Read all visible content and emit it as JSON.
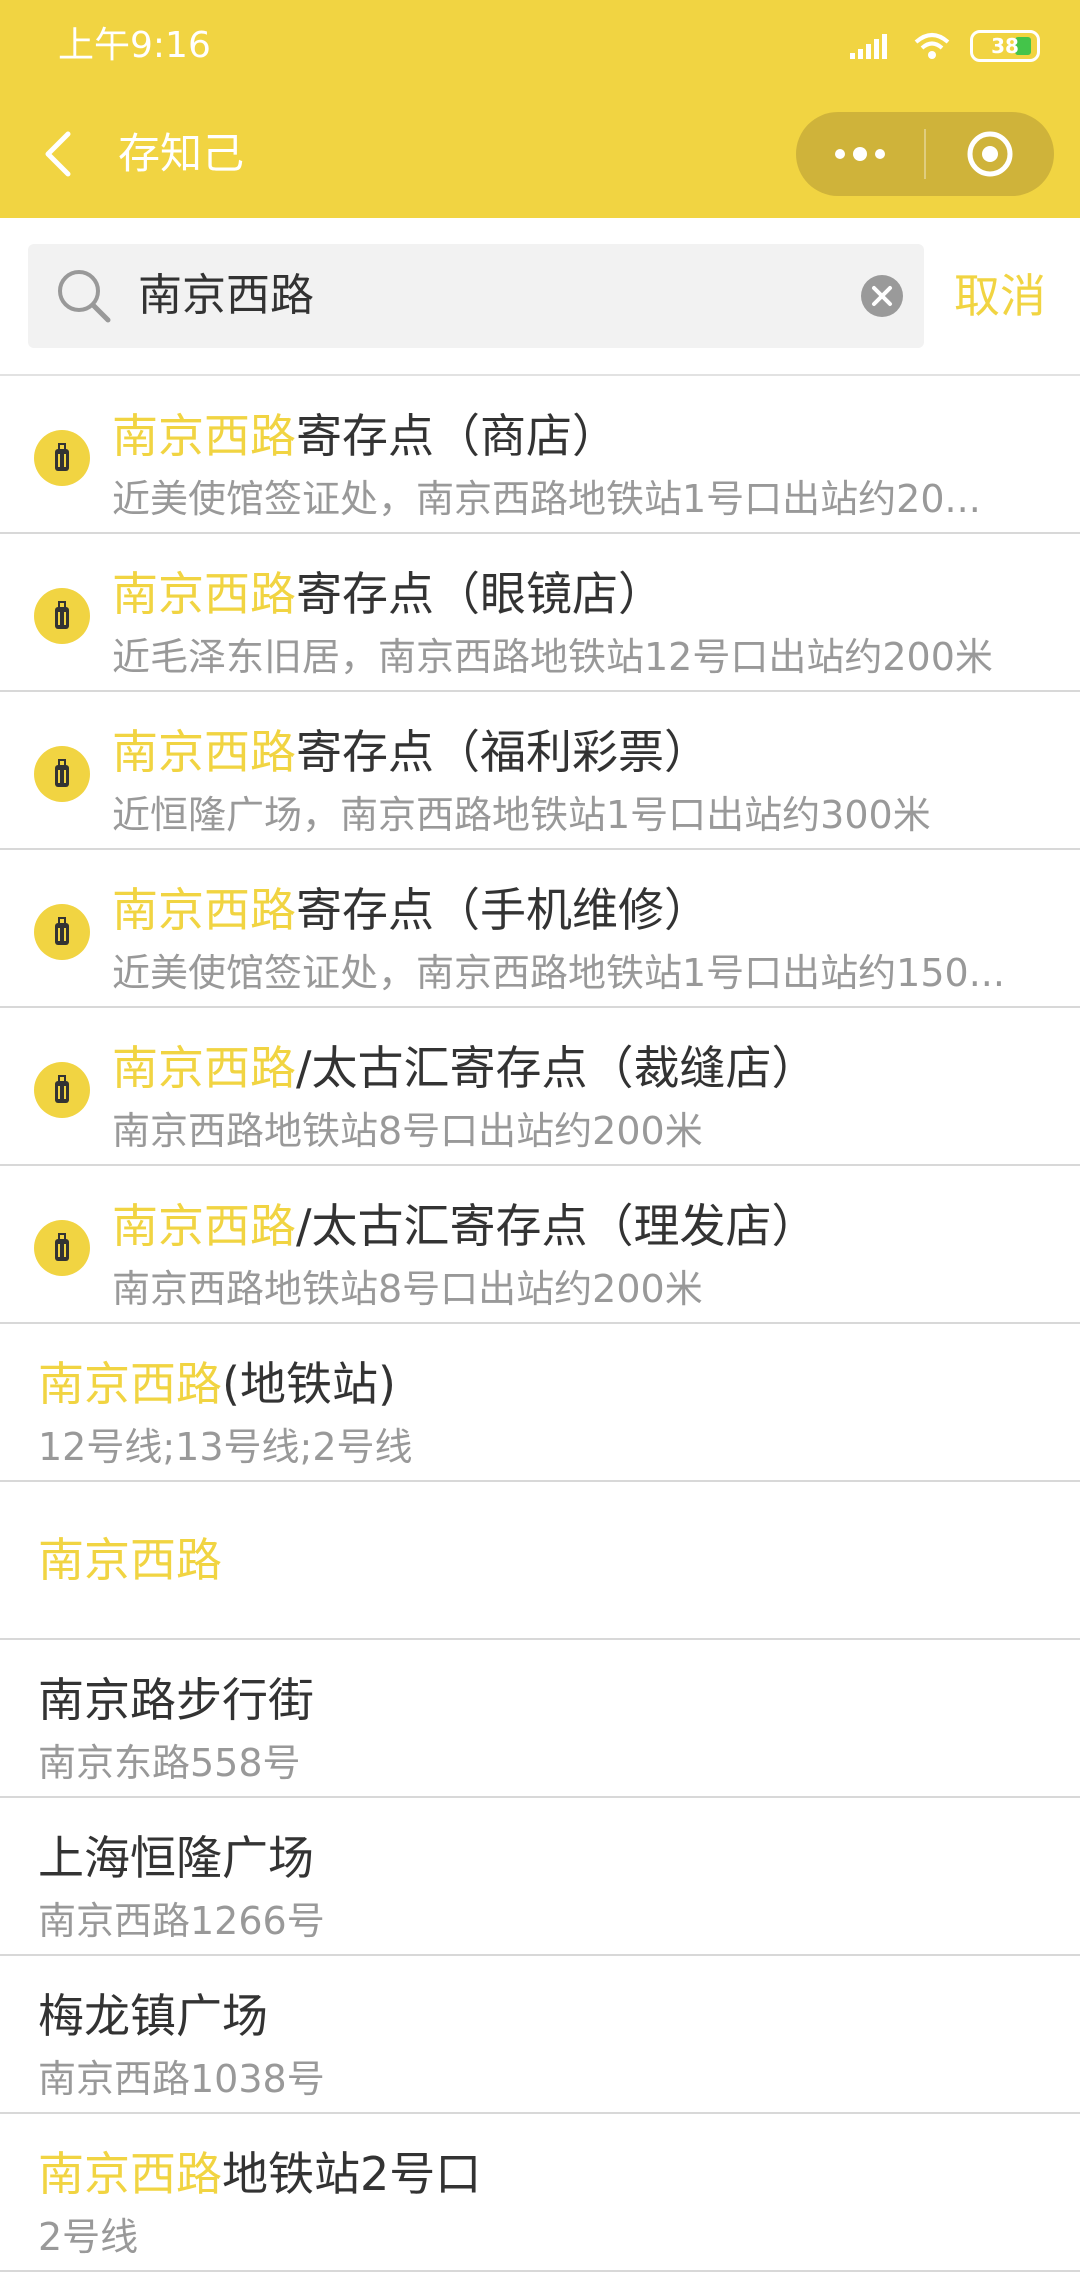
{
  "status_bar": {
    "time": "上午9:16",
    "battery": "38"
  },
  "nav": {
    "title": "存知己"
  },
  "search": {
    "query": "南京西路",
    "cancel_label": "取消"
  },
  "results": [
    {
      "highlight": "南京西路",
      "rest": "寄存点（商店）",
      "subtitle": "近美使馆签证处，南京西路地铁站1号口出站约20...",
      "icon": "storage-pin-icon"
    },
    {
      "highlight": "南京西路",
      "rest": "寄存点（眼镜店）",
      "subtitle": "近毛泽东旧居，南京西路地铁站12号口出站约200米",
      "icon": "storage-pin-icon"
    },
    {
      "highlight": "南京西路",
      "rest": "寄存点（福利彩票）",
      "subtitle": "近恒隆广场，南京西路地铁站1号口出站约300米",
      "icon": "storage-pin-icon"
    },
    {
      "highlight": "南京西路",
      "rest": "寄存点（手机维修）",
      "subtitle": "近美使馆签证处，南京西路地铁站1号口出站约150...",
      "icon": "storage-pin-icon"
    },
    {
      "highlight": "南京西路",
      "rest": "/太古汇寄存点（裁缝店）",
      "subtitle": "南京西路地铁站8号口出站约200米",
      "icon": "storage-pin-icon"
    },
    {
      "highlight": "南京西路",
      "rest": "/太古汇寄存点（理发店）",
      "subtitle": "南京西路地铁站8号口出站约200米",
      "icon": "storage-pin-icon"
    }
  ],
  "places": [
    {
      "highlight": "南京西路",
      "rest": "(地铁站)",
      "subtitle": "12号线;13号线;2号线"
    },
    {
      "highlight": "南京西路",
      "rest": "",
      "subtitle": ""
    },
    {
      "highlight": "",
      "rest": "南京路步行街",
      "subtitle": "南京东路558号"
    },
    {
      "highlight": "",
      "rest": "上海恒隆广场",
      "subtitle": "南京西路1266号"
    },
    {
      "highlight": "",
      "rest": "梅龙镇广场",
      "subtitle": "南京西路1038号"
    },
    {
      "highlight": "南京西路",
      "rest": "地铁站2号口",
      "subtitle": "2号线"
    }
  ],
  "colors": {
    "accent": "#f1d442",
    "text": "#333333",
    "muted": "#999999"
  }
}
